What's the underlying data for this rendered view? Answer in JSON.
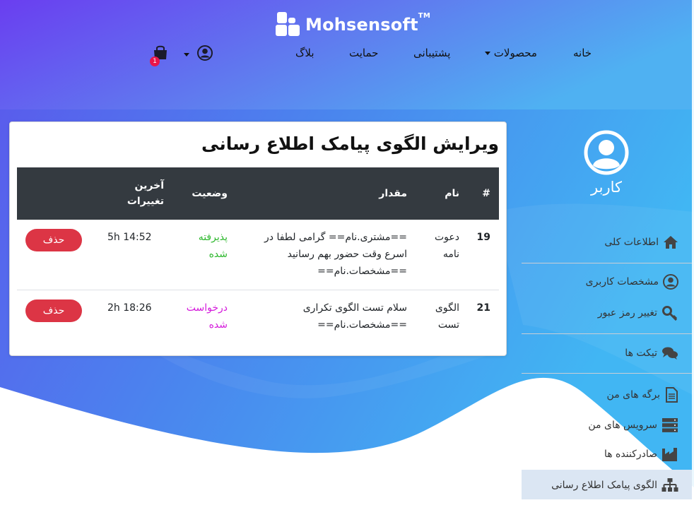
{
  "header": {
    "logo_text": "Mohsensoft",
    "logo_tm": "TM",
    "nav": {
      "home": "خانه",
      "products": "محصولات",
      "support": "پشتیبانی",
      "sponsorship": "حمایت",
      "blog": "بلاگ"
    },
    "cart_count": "1"
  },
  "main": {
    "title": "ویرایش الگوی پیامک اطلاع رسانی",
    "columns": [
      "#",
      "نام",
      "مقدار",
      "وضعیت",
      "آخرین تغییرات"
    ],
    "rows": [
      {
        "num": "19",
        "name": "دعوت نامه",
        "value": "==مشتری.نام== گرامی لطفا در اسرع وقت حضور بهم رسانید ==مشخصات.نام==",
        "status": "پذیرفته شده",
        "time": "5h 14:52",
        "action": "حذف"
      },
      {
        "num": "21",
        "name": "الگوی تست",
        "value": "سلام تست الگوی تکراری ==مشخصات.نام==",
        "status": "درخواست شده",
        "time": "2h 18:26",
        "action": "حذف"
      }
    ]
  },
  "sidebar": {
    "username": "کاربر",
    "items": [
      {
        "label": "اطلاعات کلی",
        "icon": "home-icon"
      },
      {
        "label": "مشخصات کاربری",
        "icon": "user-circle-icon"
      },
      {
        "label": "تغییر رمز عبور",
        "icon": "key-icon"
      },
      {
        "label": "تیکت ها",
        "icon": "comments-icon"
      },
      {
        "label": "برگه های من",
        "icon": "file-icon"
      },
      {
        "label": "سرویس های من",
        "icon": "server-icon"
      },
      {
        "label": "صادرکننده ها",
        "icon": "industry-icon"
      },
      {
        "label": "الگوی پیامک اطلاع رسانی",
        "icon": "sitemap-icon"
      }
    ],
    "active_index": 7
  },
  "colors": {
    "header_gradient_start": "#6a3ef0",
    "header_gradient_end": "#4fb1f2",
    "table_head": "#343a40",
    "delete_button": "#dc3545",
    "status_accepted": "#2eb82e",
    "status_requested": "#d41adb",
    "active_item": "#dbe6f3"
  }
}
